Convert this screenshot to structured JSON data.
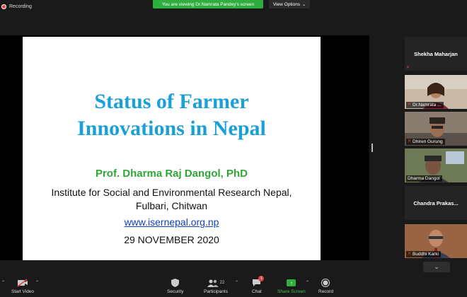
{
  "top": {
    "recording_label": "Recording",
    "share_banner": "You are viewing Dr.Namrata Pandey's screen",
    "view_options": "View Options"
  },
  "slide": {
    "title_line1": "Status of Farmer",
    "title_line2": "Innovations in Nepal",
    "presenter": "Prof. Dharma Raj Dangol, PhD",
    "institute_line1": "Institute for Social and Environmental Research Nepal,",
    "institute_line2": "Fulbari, Chitwan",
    "website": "www.isernepal.org.np",
    "date": "29 NOVEMBER 2020"
  },
  "participants": [
    {
      "name": "Shekha Maharjan",
      "video": false
    },
    {
      "name": "Dr.Namrata ...",
      "video": true
    },
    {
      "name": "Dhiren Gurung",
      "video": true
    },
    {
      "name": "Dharma Dangol",
      "video": true,
      "active": true
    },
    {
      "name": "Chandra  Prakas...",
      "video": false
    },
    {
      "name": "Buddhi Karki",
      "video": true
    }
  ],
  "toolbar": {
    "start_video": "Start Video",
    "security": "Security",
    "participants": "Participants",
    "participants_count": "22",
    "chat": "Chat",
    "chat_badge": "1",
    "share_screen": "Share Screen",
    "record": "Record"
  },
  "colors": {
    "title_blue": "#1aa0d8",
    "presenter_green": "#31a637",
    "link_blue": "#1540b8",
    "share_green": "#2fae3e",
    "active_speaker": "#d6d81b"
  }
}
